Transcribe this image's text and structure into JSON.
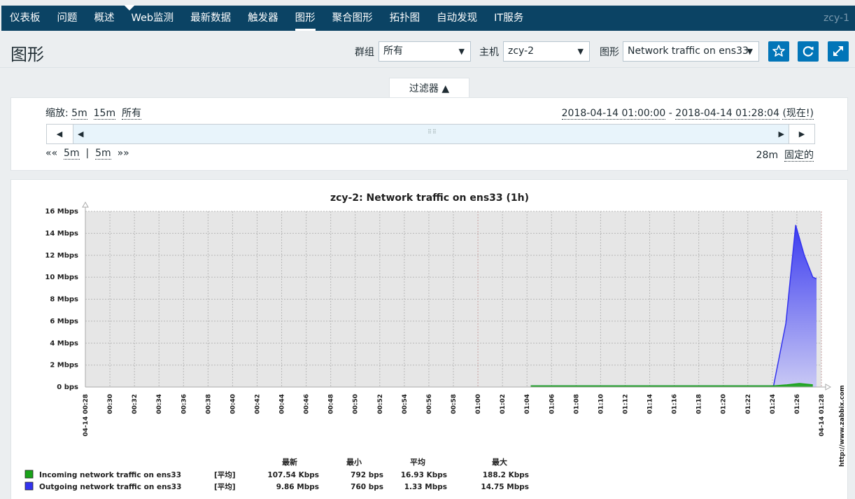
{
  "nav": {
    "items": [
      "仪表板",
      "问题",
      "概述",
      "Web监测",
      "最新数据",
      "触发器",
      "图形",
      "聚合图形",
      "拓扑图",
      "自动发现",
      "IT服务"
    ],
    "active_index": 6,
    "user": "zcy-1"
  },
  "header": {
    "title": "图形",
    "group_label": "群组",
    "group_value": "所有",
    "host_label": "主机",
    "host_value": "zcy-2",
    "graph_label": "图形",
    "graph_value": "Network traffic on ens33",
    "icons": [
      "star-icon",
      "refresh-icon",
      "fullscreen-icon"
    ],
    "accent": "#0275b8"
  },
  "filter": {
    "tab_label": "过滤器 ▲",
    "zoom_label": "缩放:",
    "zoom_links": [
      "5m",
      "15m",
      "所有"
    ],
    "range_from": "2018-04-14 01:00:00",
    "range_sep": " - ",
    "range_to": "2018-04-14 01:28:04",
    "range_now": "(现在!)",
    "nav_prev": "««",
    "nav_back": "5m",
    "nav_sep": "|",
    "nav_fwd": "5m",
    "nav_next": "»»",
    "period": "28m",
    "fixed_label": "固定的"
  },
  "graph": {
    "title": "zcy-2: Network traffic on ens33 (1h)",
    "watermark": "http://www.zabbix.com",
    "legend_headers": [
      "最新",
      "最小",
      "平均",
      "最大"
    ],
    "legend": [
      {
        "name": "Incoming network traffic on ens33",
        "func": "[平均]",
        "last": "107.54 Kbps",
        "min": "792 bps",
        "avg": "16.93 Kbps",
        "max": "188.2 Kbps",
        "color": "#1aa31a"
      },
      {
        "name": "Outgoing network traffic on ens33",
        "func": "[平均]",
        "last": "9.86 Mbps",
        "min": "760 bps",
        "avg": "1.33 Mbps",
        "max": "14.75 Mbps",
        "color": "#3333ee"
      }
    ]
  },
  "chart_data": {
    "type": "area",
    "title": "zcy-2: Network traffic on ens33 (1h)",
    "ylim": [
      0,
      16
    ],
    "y_ticks": [
      "0 bps",
      "2 Mbps",
      "4 Mbps",
      "6 Mbps",
      "8 Mbps",
      "10 Mbps",
      "12 Mbps",
      "14 Mbps",
      "16 Mbps"
    ],
    "x_ticks": [
      "04-14 00:28",
      "00:30",
      "00:32",
      "00:34",
      "00:36",
      "00:38",
      "00:40",
      "00:42",
      "00:44",
      "00:46",
      "00:48",
      "00:50",
      "00:52",
      "00:54",
      "00:56",
      "00:58",
      "01:00",
      "01:02",
      "01:04",
      "01:06",
      "01:08",
      "01:10",
      "01:12",
      "01:14",
      "01:16",
      "01:18",
      "01:20",
      "01:22",
      "01:24",
      "01:26",
      "04-14 01:28"
    ],
    "x_highlight": [
      "04-14 00:28",
      "01:00",
      "04-14 01:28"
    ],
    "x_range_minutes": [
      0,
      60
    ],
    "grid": true,
    "series": [
      {
        "name": "Incoming network traffic on ens33",
        "color": "#1aa31a",
        "x": [
          36.3,
          56.1,
          57.2,
          58.2,
          59.3
        ],
        "y": [
          0.1,
          0.1,
          0.2,
          0.32,
          0.2
        ]
      },
      {
        "name": "Outgoing network traffic on ens33",
        "color": "#3333ee",
        "x": [
          36.3,
          56.1,
          57.1,
          57.9,
          58.6,
          59.3,
          59.6
        ],
        "y": [
          0.1,
          0.1,
          5.8,
          14.75,
          12.0,
          10.0,
          9.86
        ]
      }
    ]
  }
}
